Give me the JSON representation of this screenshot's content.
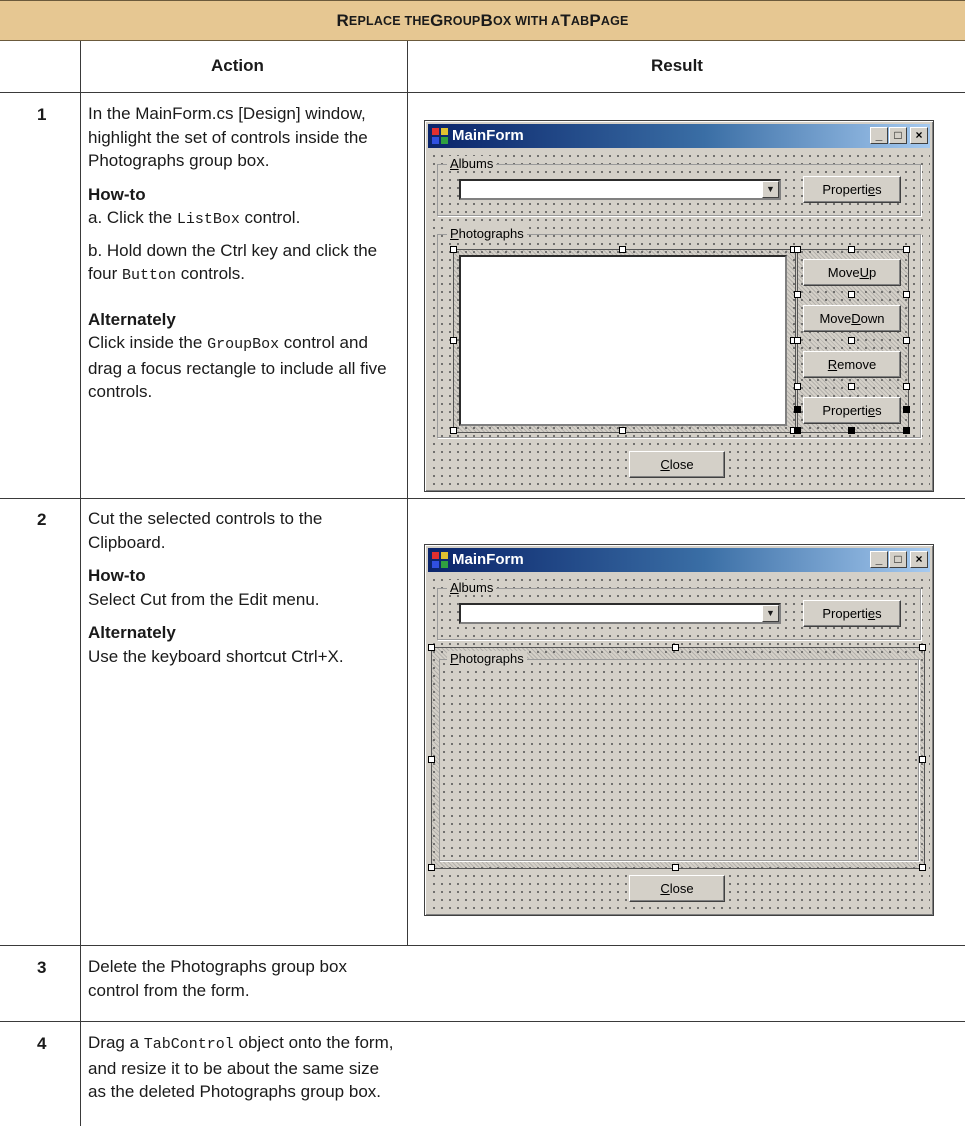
{
  "title": {
    "parts": [
      {
        "text": "R",
        "size": "big"
      },
      {
        "text": "EPLACE THE ",
        "size": "sm"
      },
      {
        "text": "G",
        "size": "big"
      },
      {
        "text": "ROUP",
        "size": "sm"
      },
      {
        "text": "B",
        "size": "big"
      },
      {
        "text": "OX WITH A ",
        "size": "sm"
      },
      {
        "text": "T",
        "size": "big"
      },
      {
        "text": "AB",
        "size": "sm"
      },
      {
        "text": "P",
        "size": "big"
      },
      {
        "text": "AGE",
        "size": "sm"
      }
    ]
  },
  "headers": {
    "action": "Action",
    "result": "Result"
  },
  "steps": [
    {
      "number": "1",
      "intro": "In the MainForm.cs [Design] window, highlight the set of controls inside the Photographs group box.",
      "howto_label": "How-to",
      "howto_a_prefix": "a. Click the ",
      "howto_a_code": "ListBox",
      "howto_a_suffix": " control.",
      "howto_b_prefix": "b. Hold down the Ctrl key and click the four ",
      "howto_b_code": "Button",
      "howto_b_suffix": " controls.",
      "alt_label": "Alternately",
      "alt_prefix": "Click inside the ",
      "alt_code": "GroupBox",
      "alt_suffix": " control and drag a focus rectangle to include all five controls."
    },
    {
      "number": "2",
      "intro": "Cut the selected controls to the Clipboard.",
      "howto_label": "How-to",
      "howto_text": "Select Cut from the Edit menu.",
      "alt_label": "Alternately",
      "alt_text": "Use the keyboard shortcut Ctrl+X."
    },
    {
      "number": "3",
      "intro": "Delete the Photographs group box control from the form."
    },
    {
      "number": "4",
      "intro_prefix": "Drag a ",
      "intro_code": "TabControl",
      "intro_suffix": " object onto the form, and resize it to be about the same size as the deleted Photographs group box."
    }
  ],
  "window": {
    "title": "MainForm",
    "minimize": "_",
    "maximize": "□",
    "close": "×",
    "albums_label": "Albums",
    "albums_accel": "A",
    "albums_rest": "lbums",
    "properties_pre": "Properti",
    "properties_accel": "e",
    "properties_post": "s",
    "photographs_label": "Photographs",
    "photos_accel": "P",
    "photos_rest": "hotographs",
    "move_up_pre": "Move ",
    "move_up_accel": "U",
    "move_up_post": "p",
    "move_down_pre": "Move ",
    "move_down_accel": "D",
    "move_down_post": "own",
    "remove_accel": "R",
    "remove_post": "emove",
    "close_accel": "C",
    "close_post": "lose",
    "dropdown_arrow": "▼"
  }
}
